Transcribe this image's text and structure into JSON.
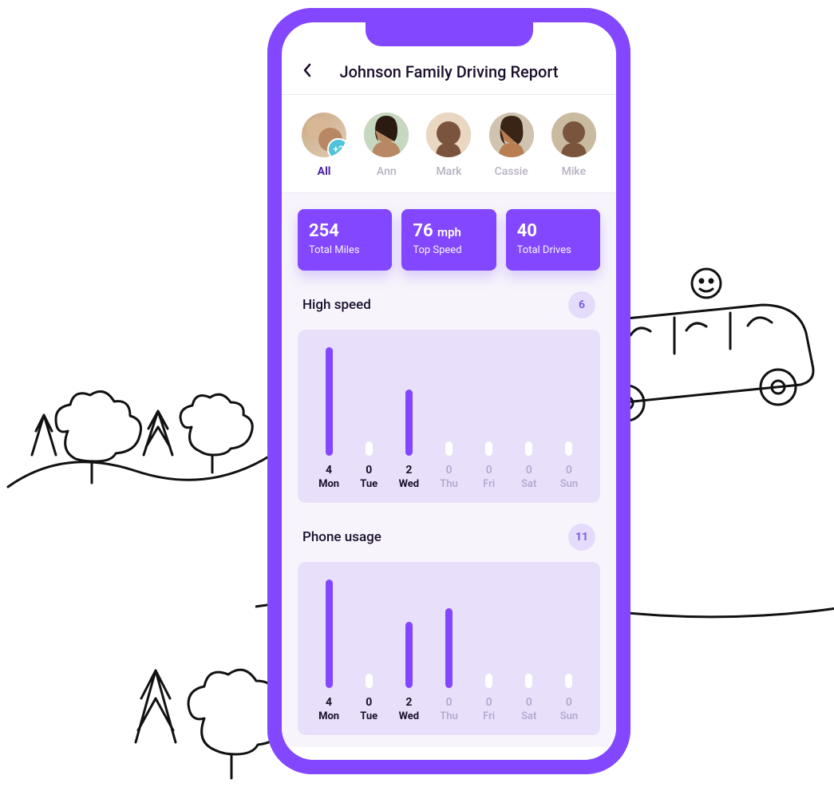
{
  "header": {
    "title": "Johnson Family Driving Report"
  },
  "members": [
    {
      "label": "All",
      "active": true,
      "badge": "+2"
    },
    {
      "label": "Ann",
      "active": false
    },
    {
      "label": "Mark",
      "active": false
    },
    {
      "label": "Cassie",
      "active": false
    },
    {
      "label": "Mike",
      "active": false
    }
  ],
  "stats": [
    {
      "value": "254",
      "unit": "",
      "label": "Total Miles"
    },
    {
      "value": "76",
      "unit": "mph",
      "label": "Top Speed"
    },
    {
      "value": "40",
      "unit": "",
      "label": "Total Drives"
    }
  ],
  "sections": [
    {
      "title": "High speed",
      "badge": "6"
    },
    {
      "title": "Phone usage",
      "badge": "11"
    }
  ],
  "chart_data": [
    {
      "type": "bar",
      "title": "High speed",
      "categories": [
        "Mon",
        "Tue",
        "Wed",
        "Thu",
        "Fri",
        "Sat",
        "Sun"
      ],
      "values": [
        4,
        0,
        2,
        0,
        0,
        0,
        0
      ],
      "active_days": [
        "Mon",
        "Tue",
        "Wed"
      ],
      "ylim": [
        0,
        4
      ]
    },
    {
      "type": "bar",
      "title": "Phone usage",
      "categories": [
        "Mon",
        "Tue",
        "Wed",
        "Thu",
        "Fri",
        "Sat",
        "Sun"
      ],
      "values": [
        4,
        0,
        2,
        0,
        0,
        0,
        0
      ],
      "active_days": [
        "Mon",
        "Tue",
        "Wed"
      ],
      "ylim": [
        0,
        4
      ],
      "note": "Thursday bar visually rendered with partial height in screenshot"
    }
  ]
}
